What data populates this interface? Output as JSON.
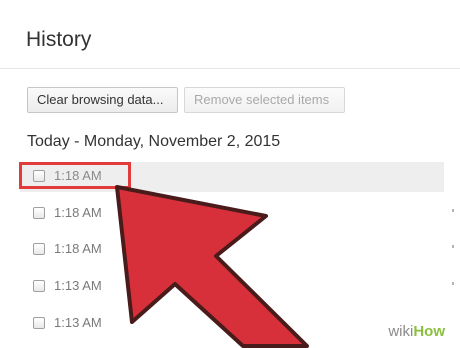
{
  "page": {
    "title": "History"
  },
  "toolbar": {
    "clear_label": "Clear browsing data...",
    "remove_label": "Remove selected items"
  },
  "day_header": "Today - Monday, November 2, 2015",
  "entries": [
    {
      "time": "1:18 AM",
      "highlighted": true
    },
    {
      "time": "1:18 AM",
      "highlighted": false
    },
    {
      "time": "1:18 AM",
      "highlighted": false
    },
    {
      "time": "1:13 AM",
      "highlighted": false
    },
    {
      "time": "1:13 AM",
      "highlighted": false
    }
  ],
  "annotation": {
    "arrow_color": "#d8303a",
    "box_color": "#e23b3b"
  },
  "watermark": {
    "wiki": "wiki",
    "how": "How"
  }
}
